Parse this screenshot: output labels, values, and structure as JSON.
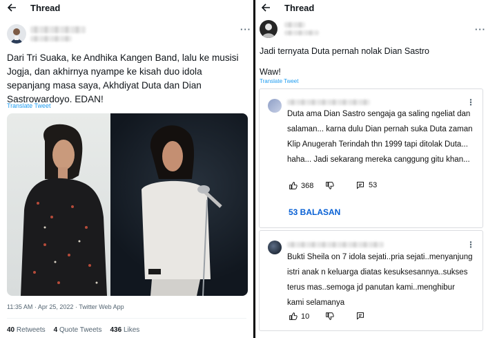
{
  "left": {
    "header_title": "Thread",
    "tweet_text": "Dari Tri Suaka, ke Andhika Kangen Band, lalu ke musisi Jogja, dan akhirnya nyampe ke kisah duo idola sepanjang masa saya, Akhdiyat Duta dan Dian Sastrowardoyo. EDAN!",
    "translate_label": "Translate Tweet",
    "meta": "11:35 AM · Apr 25, 2022 · Twitter Web App",
    "stats": {
      "retweets_count": "40",
      "retweets_label": "Retweets",
      "quotes_count": "4",
      "quotes_label": "Quote Tweets",
      "likes_count": "436",
      "likes_label": "Likes"
    }
  },
  "right": {
    "header_title": "Thread",
    "tweet_text_1": "Jadi ternyata Duta pernah nolak Dian Sastro",
    "tweet_text_2": "Waw!",
    "translate_label": "Translate Tweet",
    "comments": [
      {
        "text": "Duta ama Dian Sastro sengaja ga saling ngeliat dan salaman... karna dulu Dian pernah suka Duta zaman Klip Anugerah Terindah thn 1999 tapi ditolak Duta... haha... Jadi sekarang mereka canggung gitu khan...",
        "likes": "368",
        "replies_count": "53",
        "replies_label": "53 BALASAN"
      },
      {
        "text": "Bukti Sheila on 7 idola sejati..pria sejati..menyanjung istri anak n keluarga diatas kesuksesannya..sukses terus mas..semoga jd panutan kami..menghibur kami selamanya",
        "likes": "10"
      }
    ]
  },
  "icons": {
    "back": "arrow-left-icon",
    "more": "more-horizontal-icon",
    "kebab": "more-vertical-icon",
    "like": "thumbs-up-icon",
    "dislike": "thumbs-down-icon",
    "reply": "comment-icon"
  },
  "colors": {
    "link_blue": "#1d9bf0",
    "youtube_blue": "#065fd4",
    "secondary_text": "#536471"
  }
}
